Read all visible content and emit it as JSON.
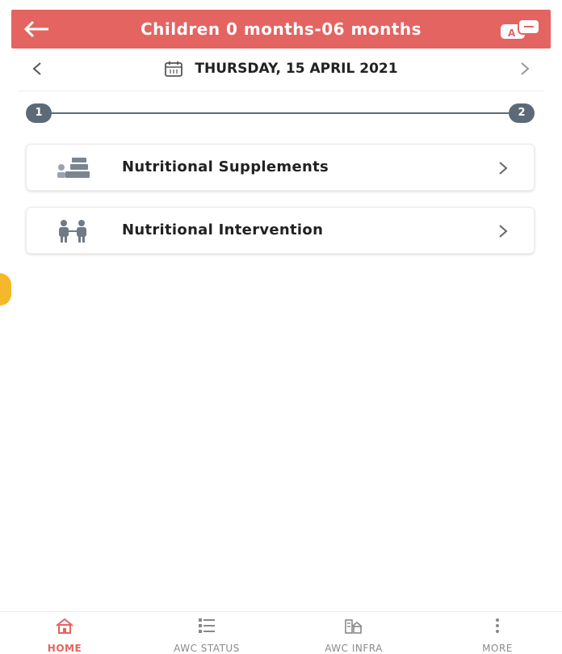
{
  "header": {
    "title": "Children 0 months-06 months",
    "back_icon": "arrow-left-icon",
    "language_icon": "language-translate-icon"
  },
  "date_nav": {
    "date": "THURSDAY, 15 APRIL 2021",
    "prev": "<",
    "next": ">"
  },
  "stepper": {
    "steps": [
      "1",
      "2"
    ]
  },
  "menu": {
    "items": [
      {
        "label": "Nutritional Supplements",
        "icon": "supplements-icon"
      },
      {
        "label": "Nutritional Intervention",
        "icon": "intervention-icon"
      }
    ]
  },
  "bottom_nav": {
    "items": [
      {
        "label": "HOME",
        "icon": "home-icon",
        "active": true
      },
      {
        "label": "AWC STATUS",
        "icon": "list-status-icon",
        "active": false
      },
      {
        "label": "AWC INFRA",
        "icon": "building-icon",
        "active": false
      },
      {
        "label": "MORE",
        "icon": "more-vertical-icon",
        "active": false
      }
    ]
  },
  "colors": {
    "primary": "#e36461",
    "stepper": "#5c6a77",
    "accent_tab": "#f5b82a"
  }
}
